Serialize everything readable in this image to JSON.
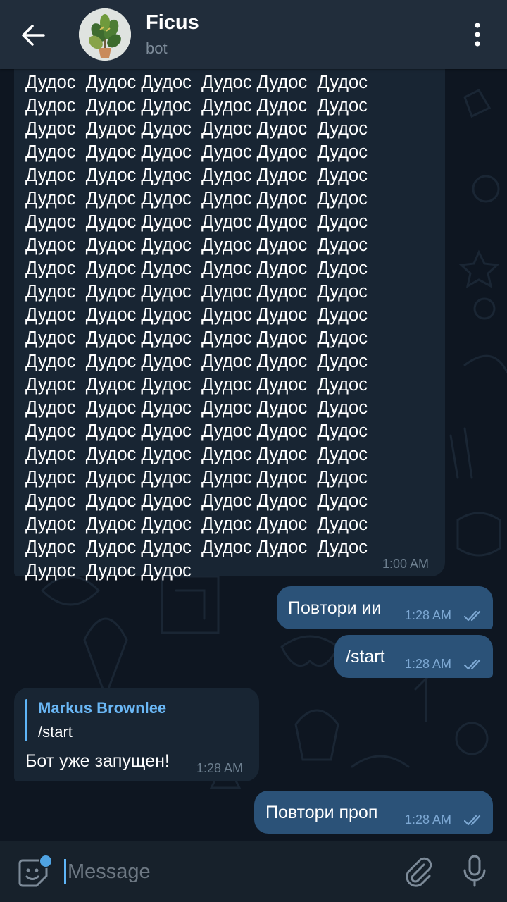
{
  "header": {
    "title": "Ficus",
    "subtitle": "bot",
    "back_icon": "arrow-left-icon",
    "menu_icon": "more-vertical-icon"
  },
  "messages": [
    {
      "direction": "in",
      "text": "Дудос  Дудос Дудос  Дудос Дудос  Дудос\nДудос  Дудос Дудос  Дудос Дудос  Дудос\nДудос  Дудос Дудос  Дудос Дудос  Дудос\nДудос  Дудос Дудос  Дудос Дудос  Дудос\nДудос  Дудос Дудос  Дудос Дудос  Дудос\nДудос  Дудос Дудос  Дудос Дудос  Дудос\nДудос  Дудос Дудос  Дудос Дудос  Дудос\nДудос  Дудос Дудос  Дудос Дудос  Дудос\nДудос  Дудос Дудос  Дудос Дудос  Дудос\nДудос  Дудос Дудос  Дудос Дудос  Дудос\nДудос  Дудос Дудос  Дудос Дудос  Дудос\nДудос  Дудос Дудос  Дудос Дудос  Дудос\nДудос  Дудос Дудос  Дудос Дудос  Дудос\nДудос  Дудос Дудос  Дудос Дудос  Дудос\nДудос  Дудос Дудос  Дудос Дудос  Дудос\nДудос  Дудос Дудос  Дудос Дудос  Дудос\nДудос  Дудос Дудос  Дудос Дудос  Дудос\nДудос  Дудос Дудос  Дудос Дудос  Дудос\nДудос  Дудос Дудос  Дудос Дудос  Дудос\nДудос  Дудос Дудос  Дудос Дудос  Дудос\nДудос  Дудос Дудос  Дудос Дудос  Дудос\nДудос  Дудос Дудос  Дудос Дудос  Дудос\nДудос  Дудос Дудос",
      "time": "1:00 AM"
    },
    {
      "direction": "out",
      "text": "Повтори ии",
      "time": "1:28 AM",
      "status": "read"
    },
    {
      "direction": "out",
      "text": "/start",
      "time": "1:28 AM",
      "status": "read"
    },
    {
      "direction": "in",
      "reply_to": {
        "name": "Markus Brownlee",
        "text": "/start"
      },
      "text": "Бот уже запущен!",
      "time": "1:28 AM"
    },
    {
      "direction": "out",
      "text": "Повтори проп",
      "time": "1:28 AM",
      "status": "read"
    }
  ],
  "input": {
    "placeholder": "Message",
    "value": "",
    "emoji_icon": "sticker-icon",
    "attach_icon": "paperclip-icon",
    "mic_icon": "microphone-icon"
  },
  "colors": {
    "background": "#0e1621",
    "header": "#212d3b",
    "incoming_bubble": "#182533",
    "outgoing_bubble": "#2b5278",
    "accent": "#5eb5f7"
  }
}
